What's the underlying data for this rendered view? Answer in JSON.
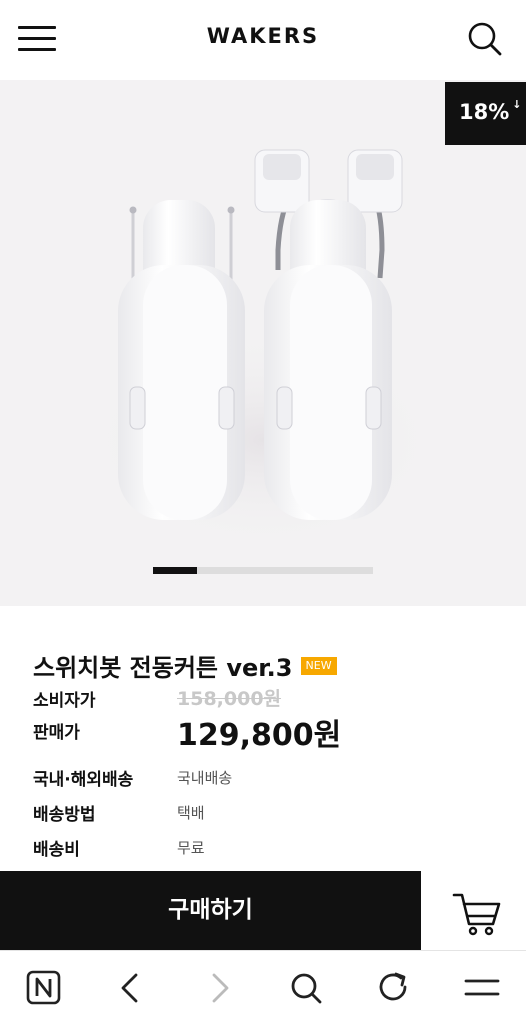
{
  "header": {
    "logo": "WAKERS",
    "menu_icon": "hamburger-menu-icon",
    "search_icon": "search-icon"
  },
  "hero": {
    "discount_label": "18%",
    "discount_arrow": "↓",
    "slide_progress": 0.2
  },
  "product": {
    "title": "스위치봇 전동커튼 ver.3",
    "badge": "NEW",
    "consumer_price_label": "소비자가",
    "consumer_price": "158,000원",
    "sale_price_label": "판매가",
    "sale_price": "129,800원",
    "shipping_type_label": "국내·해외배송",
    "shipping_type": "국내배송",
    "shipping_method_label": "배송방법",
    "shipping_method": "택배",
    "shipping_fee_label": "배송비",
    "shipping_fee": "무료"
  },
  "actions": {
    "buy_label": "구매하기",
    "cart_icon": "cart-icon"
  },
  "browser_nav": {
    "icons": [
      "naver-home-icon",
      "back-icon",
      "forward-icon",
      "search-icon",
      "refresh-icon",
      "menu-icon"
    ]
  },
  "colors": {
    "accent_badge": "#f7a800",
    "dark": "#111111",
    "hero_bg": "#f3f2f3"
  }
}
